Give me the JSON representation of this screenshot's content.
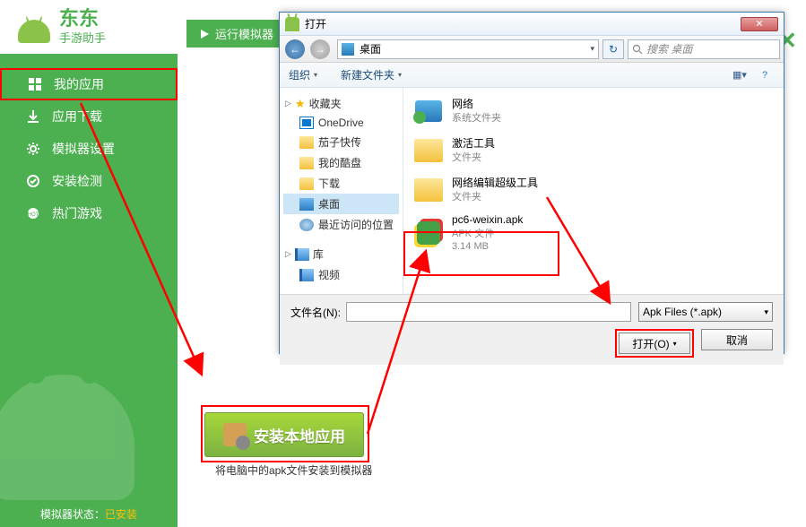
{
  "logo": {
    "title": "东东",
    "subtitle": "手游助手"
  },
  "sidebar": {
    "items": [
      {
        "label": "我的应用"
      },
      {
        "label": "应用下载"
      },
      {
        "label": "模拟器设置"
      },
      {
        "label": "安装检测"
      },
      {
        "label": "热门游戏"
      }
    ]
  },
  "status": {
    "label": "模拟器状态：",
    "value": "已安装"
  },
  "run_emulator": "运行模拟器",
  "install_local": {
    "button": "安装本地应用",
    "caption": "将电脑中的apk文件安装到模拟器"
  },
  "dialog": {
    "title": "打开",
    "address": "桌面",
    "search_placeholder": "搜索 桌面",
    "toolbar": {
      "organize": "组织",
      "new_folder": "新建文件夹"
    },
    "tree": {
      "favorites": "收藏夹",
      "favorites_items": [
        {
          "label": "OneDrive"
        },
        {
          "label": "茄子快传"
        },
        {
          "label": "我的酷盘"
        },
        {
          "label": "下载"
        },
        {
          "label": "桌面"
        },
        {
          "label": "最近访问的位置"
        }
      ],
      "libraries": "库",
      "libraries_items": [
        {
          "label": "视频"
        }
      ]
    },
    "files": [
      {
        "name": "网络",
        "sub1": "系统文件夹",
        "sub2": ""
      },
      {
        "name": "激活工具",
        "sub1": "文件夹",
        "sub2": ""
      },
      {
        "name": "网络编辑超级工具",
        "sub1": "文件夹",
        "sub2": ""
      },
      {
        "name": "pc6-weixin.apk",
        "sub1": "APK 文件",
        "sub2": "3.14 MB"
      }
    ],
    "filename_label": "文件名(N):",
    "filter": "Apk Files (*.apk)",
    "open_btn": "打开(O)",
    "cancel_btn": "取消"
  }
}
